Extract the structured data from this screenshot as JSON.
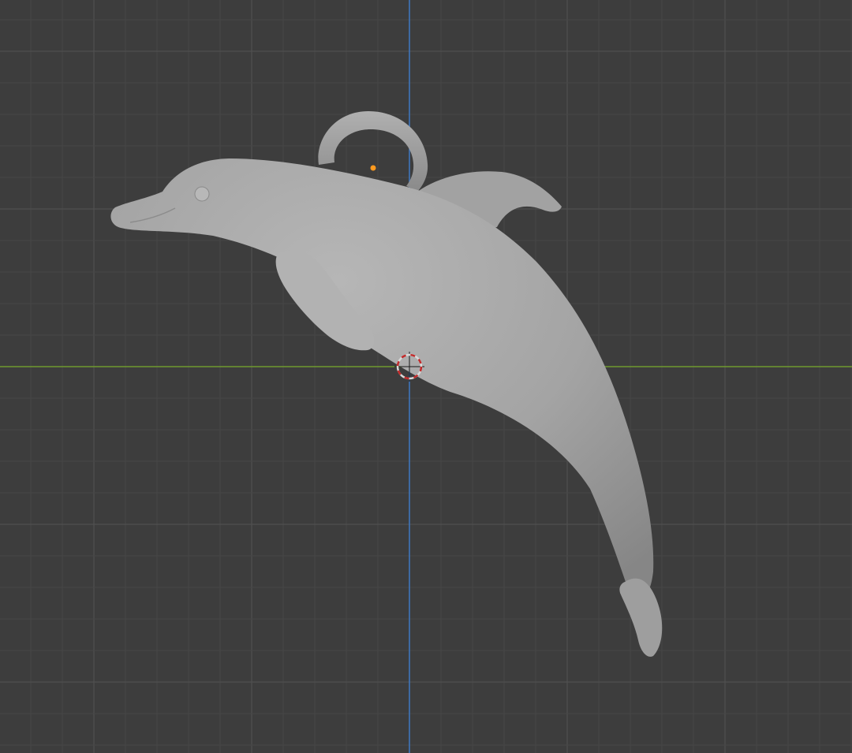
{
  "viewport": {
    "background_color": "#3d3d3d",
    "grid_minor_color": "#474747",
    "grid_major_color": "#525252",
    "x_axis_color": "#6f9a2e",
    "y_axis_color": "#3f79c4",
    "mesh_color": "#a9a9a9",
    "origin_dot_color": "#ff9a1f",
    "cursor_ring_colors": [
      "#d8d8d8",
      "#c22a2a"
    ],
    "icons": {
      "object_origin": "origin-dot-icon",
      "cursor": "3d-cursor-icon"
    }
  }
}
